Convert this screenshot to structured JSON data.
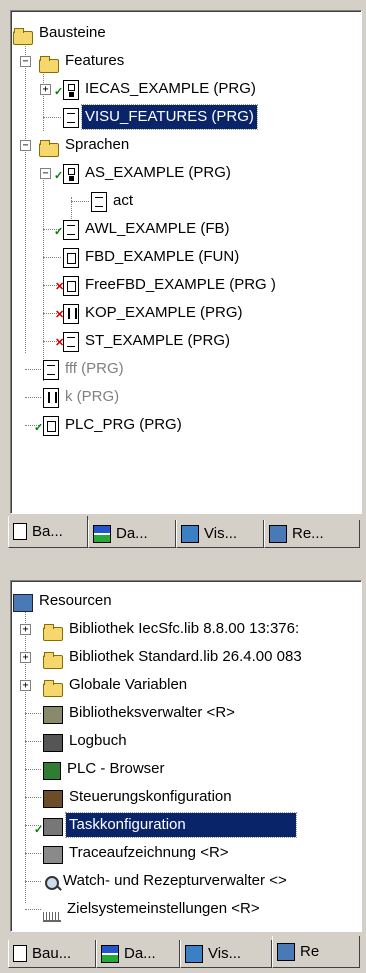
{
  "panel_objects": {
    "tree": [
      {
        "label": "Bausteine",
        "icon": "folder-icon"
      },
      {
        "label": "Features",
        "icon": "folder-icon"
      },
      {
        "label": "IECAS_EXAMPLE (PRG)",
        "icon": "sfc-icon"
      },
      {
        "label": "VISU_FEATURES (PRG)",
        "icon": "st-document-icon",
        "selected": true
      },
      {
        "label": "Sprachen",
        "icon": "folder-icon"
      },
      {
        "label": "AS_EXAMPLE (PRG)",
        "icon": "sfc-icon"
      },
      {
        "label": "act",
        "icon": "st-document-icon"
      },
      {
        "label": "AWL_EXAMPLE (FB)",
        "icon": "il-document-icon"
      },
      {
        "label": "FBD_EXAMPLE (FUN)",
        "icon": "fbd-icon"
      },
      {
        "label": "FreeFBD_EXAMPLE (PRG  )",
        "icon": "fbd-icon"
      },
      {
        "label": "KOP_EXAMPLE (PRG)",
        "icon": "ladder-icon"
      },
      {
        "label": "ST_EXAMPLE (PRG)",
        "icon": "st-document-icon"
      },
      {
        "label": "fff (PRG)",
        "icon": "st-document-icon"
      },
      {
        "label": "k (PRG)",
        "icon": "ladder-icon"
      },
      {
        "label": "PLC_PRG (PRG)",
        "icon": "fbd-icon"
      }
    ],
    "tabs": [
      "Ba...",
      "Da...",
      "Vis...",
      "Re..."
    ]
  },
  "panel_resources": {
    "tree": [
      {
        "label": "Resourcen",
        "icon": "resources-icon"
      },
      {
        "label": "Bibliothek IecSfc.lib 8.8.00 13:376:",
        "icon": "folder-icon"
      },
      {
        "label": "Bibliothek Standard.lib 26.4.00 083",
        "icon": "folder-icon"
      },
      {
        "label": "Globale Variablen",
        "icon": "folder-icon"
      },
      {
        "label": "Bibliotheksverwalter <R>",
        "icon": "library-manager-icon"
      },
      {
        "label": "Logbuch",
        "icon": "logbook-icon"
      },
      {
        "label": "PLC - Browser",
        "icon": "plc-browser-icon"
      },
      {
        "label": "Steuerungskonfiguration",
        "icon": "plc-configuration-icon"
      },
      {
        "label": "Taskkonfiguration",
        "icon": "task-configuration-icon",
        "selected": true
      },
      {
        "label": "Traceaufzeichnung <R>",
        "icon": "trace-icon"
      },
      {
        "label": "Watch- und Rezepturverwalter <>",
        "icon": "watch-icon"
      },
      {
        "label": "Zielsystemeinstellungen <R>",
        "icon": "target-settings-icon"
      }
    ],
    "tabs": [
      "Bau...",
      "Da...",
      "Vis...",
      "Re"
    ]
  },
  "colors": {
    "selection": "#0a246a",
    "window": "#d4d0c8",
    "ok_mark": "#008000",
    "error_mark": "#d00000"
  }
}
